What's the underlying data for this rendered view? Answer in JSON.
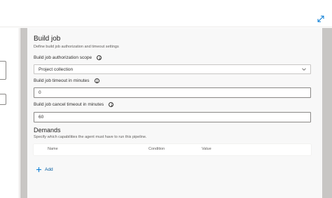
{
  "build_job": {
    "title": "Build job",
    "description": "Define build job authorization and timeout settings",
    "authorization_scope": {
      "label": "Build job authorization scope",
      "value": "Project collection"
    },
    "timeout": {
      "label": "Build job timeout in minutes",
      "value": "0"
    },
    "cancel_timeout": {
      "label": "Build job cancel timeout in minutes",
      "value": "60"
    }
  },
  "demands": {
    "title": "Demands",
    "description": "Specify which capabilities the agent must have to run this pipeline.",
    "columns": [
      "Name",
      "Condition",
      "Value"
    ],
    "add_label": "Add"
  },
  "colors": {
    "accent": "#0078d4",
    "panel_bg": "#f8f8f8",
    "gutter": "#c8c6c4"
  },
  "icons": [
    "expand-icon",
    "info-icon",
    "chevron-down-icon",
    "add-icon"
  ]
}
